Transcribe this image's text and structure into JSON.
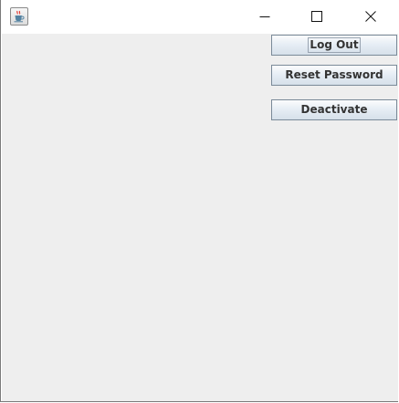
{
  "window": {
    "icon": "java-coffee-cup-icon",
    "controls": {
      "minimize": "minimize-icon",
      "maximize": "maximize-icon",
      "close": "close-icon"
    }
  },
  "actions": {
    "logout_label": "Log Out",
    "reset_password_label": "Reset Password",
    "deactivate_label": "Deactivate"
  },
  "colors": {
    "content_background": "#eeeeee",
    "button_border": "#7a8a99",
    "button_text": "#333333"
  }
}
